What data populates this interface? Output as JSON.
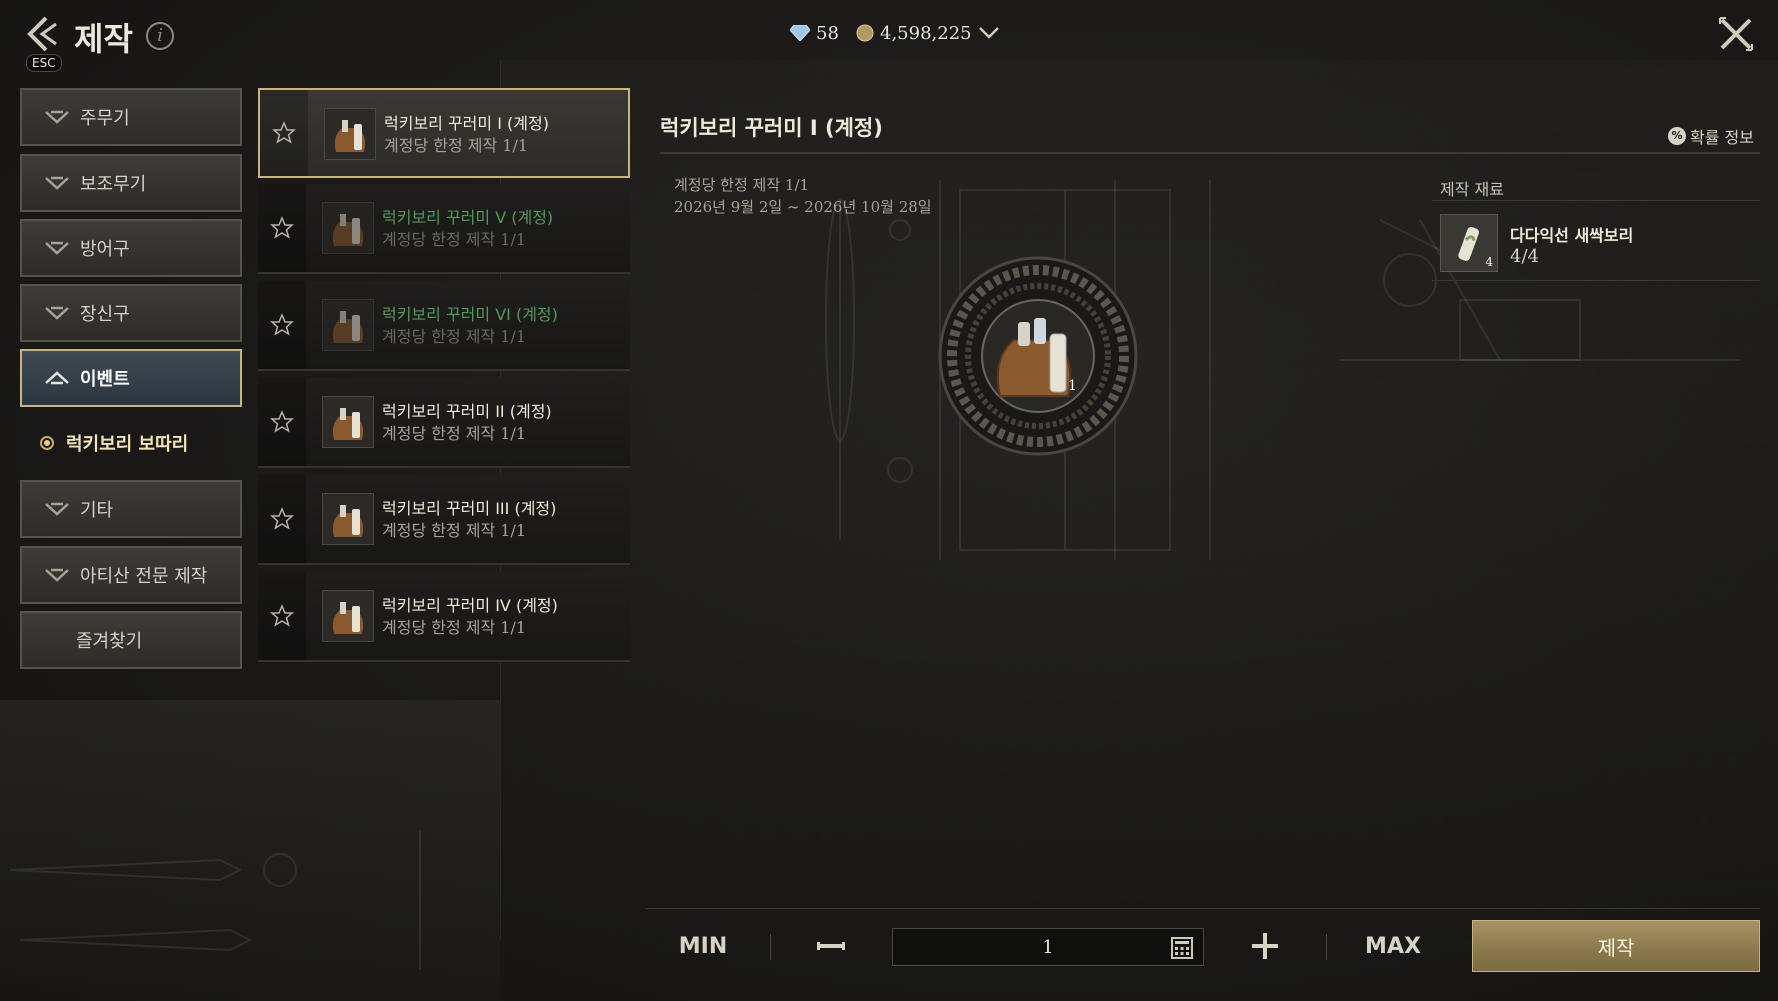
{
  "header": {
    "title": "제작",
    "esc_label": "ESC",
    "info_glyph": "i",
    "gems": "58",
    "gold": "4,598,225"
  },
  "categories": [
    {
      "label": "주무기"
    },
    {
      "label": "보조무기"
    },
    {
      "label": "방어구"
    },
    {
      "label": "장신구"
    },
    {
      "label": "이벤트"
    },
    {
      "label": "기타"
    },
    {
      "label": "아티산 전문 제작"
    },
    {
      "label": "즐겨찾기"
    }
  ],
  "sub_category": {
    "label": "럭키보리 보따리"
  },
  "recipes": [
    {
      "name": "럭키보리 꾸러미 I (계정)",
      "sub": "계정당 한정 제작 1/1",
      "thumb_count": "1"
    },
    {
      "name": "럭키보리 꾸러미 V (계정)",
      "sub": "계정당 한정 제작 1/1"
    },
    {
      "name": "럭키보리 꾸러미 VI (계정)",
      "sub": "계정당 한정 제작 1/1"
    },
    {
      "name": "럭키보리 꾸러미 II (계정)",
      "sub": "계정당 한정 제작 1/1"
    },
    {
      "name": "럭키보리 꾸러미 III (계정)",
      "sub": "계정당 한정 제작 1/1"
    },
    {
      "name": "럭키보리 꾸러미 IV (계정)",
      "sub": "계정당 한정 제작 1/1"
    }
  ],
  "detail": {
    "title": "럭키보리 꾸러미 I (계정)",
    "odds_label": "확률 정보",
    "odds_glyph": "%",
    "limit": "계정당 한정 제작 1/1",
    "period": "2026년 9월 2일 ~ 2026년 10월 28일",
    "result_count": "1"
  },
  "materials": {
    "header": "제작 재료",
    "items": [
      {
        "name": "다다익선 새싹보리",
        "qty": "4/4",
        "badge": "4"
      }
    ]
  },
  "bottom": {
    "min_label": "MIN",
    "max_label": "MAX",
    "quantity": "1",
    "craft_label": "제작"
  },
  "colors": {
    "accent_gold": "#c9b47a",
    "craft_button": "#a69464",
    "unavailable_green": "#4e9a58"
  }
}
